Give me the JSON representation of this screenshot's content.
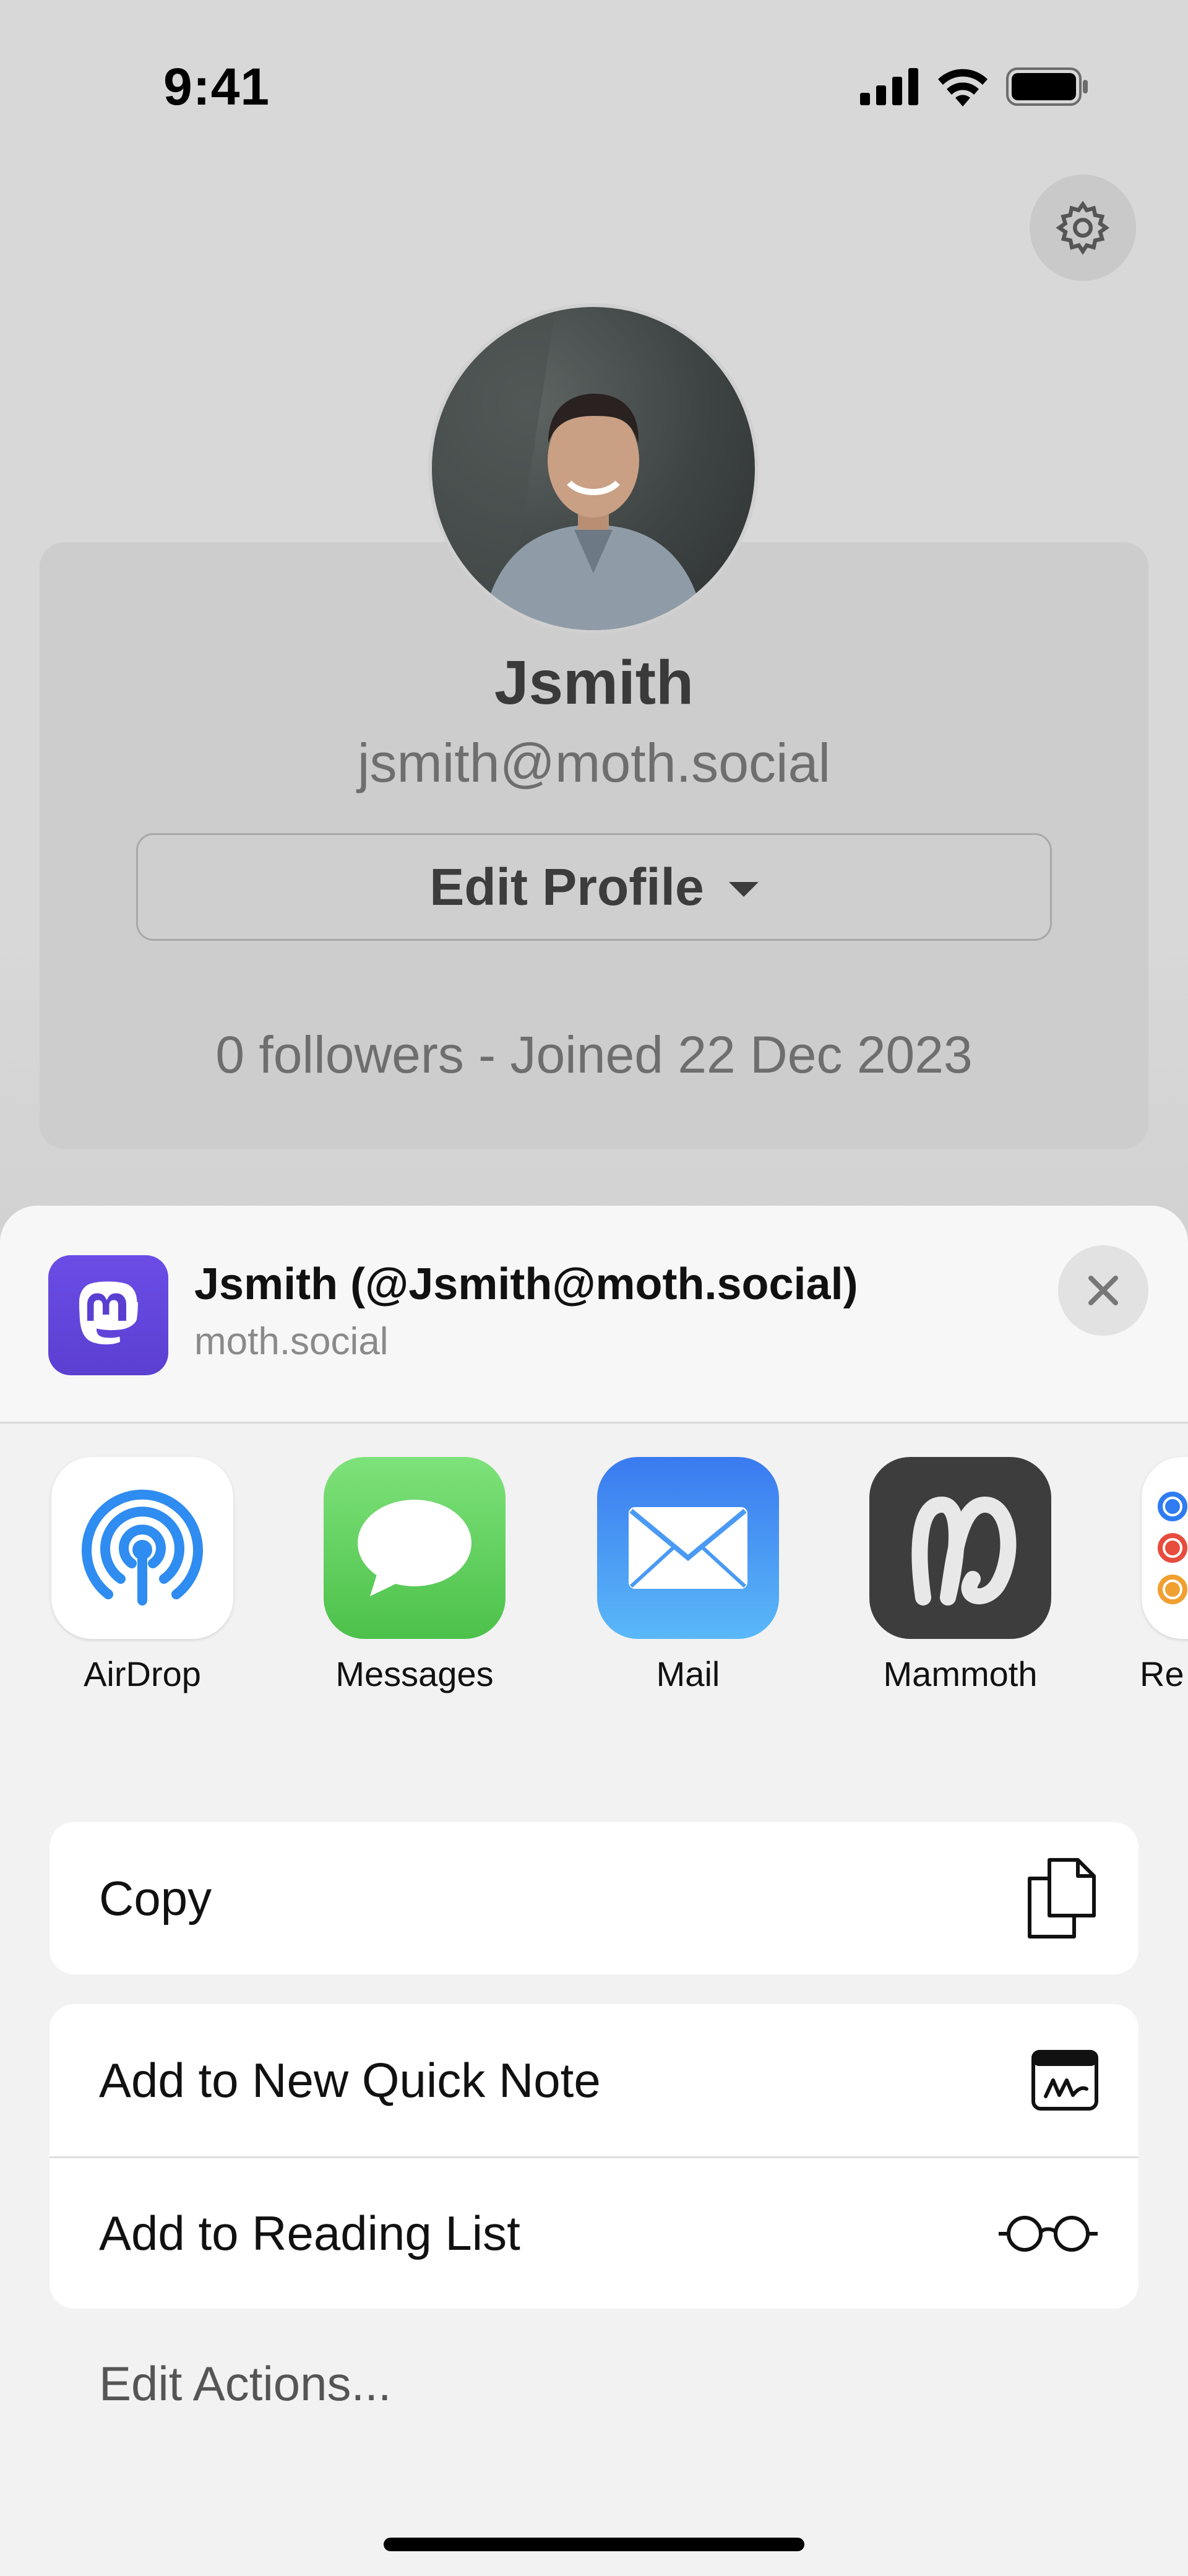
{
  "status_bar": {
    "time": "9:41"
  },
  "profile": {
    "name": "Jsmith",
    "handle": "jsmith@moth.social",
    "edit_button": "Edit Profile",
    "stats": "0 followers - Joined 22 Dec 2023"
  },
  "share_sheet": {
    "title": "Jsmith (@Jsmith@moth.social)",
    "subtitle": "moth.social",
    "apps": [
      {
        "label": "AirDrop",
        "icon": "airdrop-icon"
      },
      {
        "label": "Messages",
        "icon": "messages-icon"
      },
      {
        "label": "Mail",
        "icon": "mail-icon"
      },
      {
        "label": "Mammoth",
        "icon": "mammoth-icon"
      },
      {
        "label": "Re",
        "icon": "reminders-icon"
      }
    ],
    "actions": {
      "copy": "Copy",
      "quick_note": "Add to New Quick Note",
      "reading_list": "Add to Reading List"
    },
    "edit_actions": "Edit Actions..."
  },
  "colors": {
    "mastodon_purple": "#5b3fd1",
    "messages_green": "#5ac85a",
    "mail_blue": "#3a8ef0",
    "mammoth_dark": "#3d3d3d"
  }
}
